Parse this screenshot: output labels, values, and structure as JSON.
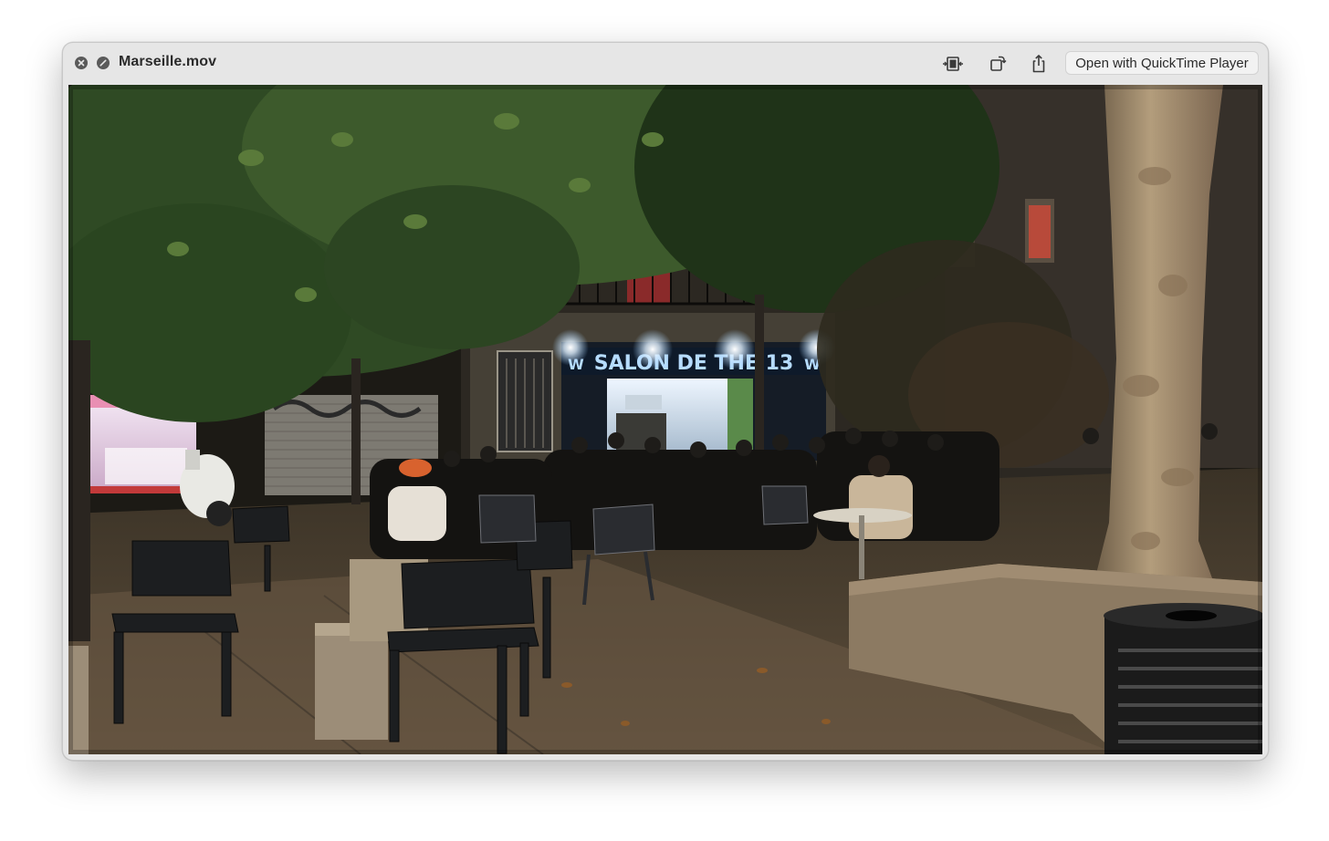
{
  "window": {
    "title": "Marseille.mov"
  },
  "toolbar": {
    "close_icon": "close-icon",
    "minimize_icon": "minimize-icon",
    "trim_icon": "trim-icon",
    "rotate_icon": "rotate-icon",
    "share_icon": "share-icon",
    "open_with_label": "Open with QuickTime Player"
  },
  "video": {
    "sign_text": "SALON DE THE 13"
  },
  "colors": {
    "window_bg": "#e6e6e6",
    "sign_blue": "#a8d8ff"
  }
}
